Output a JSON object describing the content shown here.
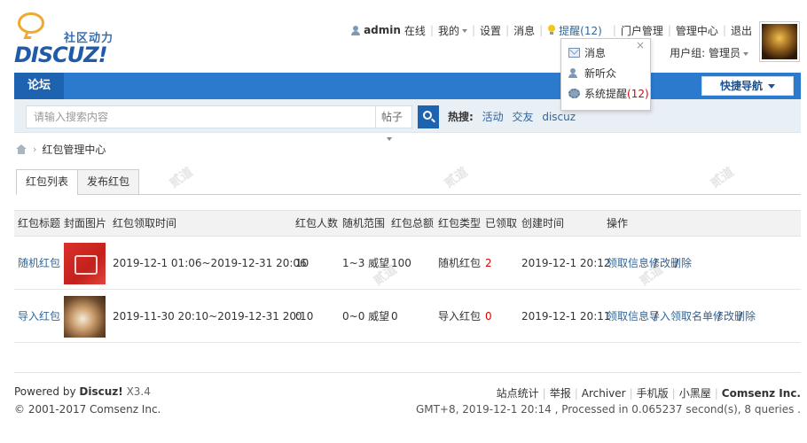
{
  "header": {
    "logo_slogan": "社区动力",
    "logo_word": "DISCUZ!",
    "username": "admin",
    "status": "在线",
    "my": "我的",
    "settings": "设置",
    "messages": "消息",
    "remind": "提醒(12)",
    "portal_admin": "门户管理",
    "admin_center": "管理中心",
    "logout": "退出",
    "usergroup": "用户组: 管理员"
  },
  "popup": {
    "close": "×",
    "items": [
      {
        "label": "消息",
        "count": ""
      },
      {
        "label": "新听众",
        "count": ""
      },
      {
        "label": "系统提醒",
        "count": "(12)"
      }
    ]
  },
  "nav": {
    "home": "论坛",
    "quick_nav": "快捷导航"
  },
  "search": {
    "placeholder": "请输入搜索内容",
    "type": "帖子",
    "hot_label": "热搜:",
    "hot_words": [
      "活动",
      "交友",
      "discuz"
    ]
  },
  "breadcrumb": {
    "arrow": "›",
    "current": "红包管理中心"
  },
  "tabs": [
    "红包列表",
    "发布红包"
  ],
  "table": {
    "headers": [
      "红包标题",
      "封面图片",
      "红包领取时间",
      "红包人数",
      "随机范围",
      "红包总额",
      "红包类型",
      "已领取",
      "创建时间",
      "操作"
    ],
    "rows": [
      {
        "title": "随机红包",
        "time": "2019-12-1 01:06~2019-12-31 20:06",
        "count": "10",
        "range": "1~3 威望",
        "total": "100",
        "type": "随机红包",
        "received": "2",
        "created": "2019-12-1 20:12",
        "ops": [
          "领取信息",
          "修改",
          "删除"
        ]
      },
      {
        "title": "导入红包",
        "time": "2019-11-30 20:10~2019-12-31 20:10",
        "count": "0",
        "range": "0~0 威望",
        "total": "0",
        "type": "导入红包",
        "received": "0",
        "created": "2019-12-1 20:11",
        "ops": [
          "领取信息",
          "导入领取名单",
          "修改",
          "删除"
        ]
      }
    ]
  },
  "footer": {
    "powered_by": "Powered by",
    "product": "Discuz!",
    "version": "X3.4",
    "copyright": "© 2001-2017 Comsenz Inc.",
    "links": [
      "站点统计",
      "举报",
      "Archiver",
      "手机版",
      "小黑屋"
    ],
    "company": "Comsenz Inc.",
    "stats": "GMT+8, 2019-12-1 20:14 , Processed in 0.065237 second(s), 8 queries ."
  },
  "watermark": "贰道"
}
